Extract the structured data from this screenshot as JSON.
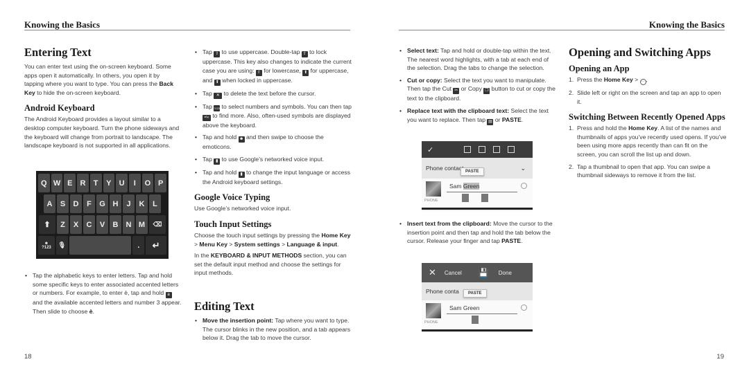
{
  "left_page": {
    "running_head": "Knowing the Basics",
    "page_number": "18",
    "entering_text": {
      "title": "Entering Text",
      "body_pre": "You can enter text using the on-screen keyboard. Some apps open it automatically. In others, you open it by tapping where you want to type. You can press the ",
      "body_bold": "Back Key",
      "body_post": " to hide the on-screen keyboard."
    },
    "android_keyboard": {
      "title": "Android Keyboard",
      "body": "The Android Keyboard provides a layout similar to a desktop computer keyboard. Turn the phone sideways and the keyboard will change from portrait to landscape. The landscape keyboard is not supported in all applications."
    },
    "keyboard": {
      "row1": [
        "Q",
        "W",
        "E",
        "R",
        "T",
        "Y",
        "U",
        "I",
        "O",
        "P"
      ],
      "row2": [
        "A",
        "S",
        "D",
        "F",
        "G",
        "H",
        "J",
        "K",
        "L"
      ],
      "row3": [
        "Z",
        "X",
        "C",
        "V",
        "B",
        "N",
        "M"
      ],
      "symbols_key": "?123",
      "period_key": "."
    },
    "alpha_bullet": {
      "pre": "Tap the alphabetic keys to enter letters. Tap and hold some specific keys to enter associated accented letters or numbers. For example, to enter è, tap and hold ",
      "mid": " and the available accented letters and number 3 appear. Then slide to choose ",
      "bold_end": "è",
      "end": "."
    },
    "bullets": {
      "shift_a": "Tap ",
      "shift_b": " to use uppercase. Double-tap ",
      "shift_c": " to lock uppercase. This key also changes to indicate the current case you are using: ",
      "shift_d": " for lowercase, ",
      "shift_e": " for uppercase, and ",
      "shift_f": " when locked in uppercase.",
      "delete_a": "Tap ",
      "delete_b": " to delete the text before the cursor.",
      "symbols_a": "Tap ",
      "symbols_b": " to select numbers and symbols. You can then tap ",
      "symbols_c": " to find more. Also, often-used symbols are displayed above the keyboard.",
      "emoticons_a": "Tap and hold ",
      "emoticons_b": " and then swipe to choose the emoticons.",
      "voice_a": "Tap ",
      "voice_b": " to use Google’s networked voice input.",
      "lang_a": "Tap and hold ",
      "lang_b": " to change the input language or access the Android keyboard settings.",
      "key_glyph_symbols": "?123",
      "key_glyph_more": "=\\<",
      "key_glyph_a": "a"
    },
    "google_voice": {
      "title": "Google Voice Typing",
      "body": "Use Google’s networked voice input."
    },
    "touch_input": {
      "title": "Touch Input Settings",
      "p1_pre": "Choose the touch input settings by pressing the ",
      "p1_b1": "Home Key",
      "p1_s1": " > ",
      "p1_b2": "Menu Key",
      "p1_s2": " > ",
      "p1_b3": "System settings",
      "p1_s3": " > ",
      "p1_b4": "Language & input",
      "p1_end": ".",
      "p2_pre": "In the ",
      "p2_bold": "KEYBOARD & INPUT METHODS",
      "p2_post": " section, you can set the default input method and choose the settings for input methods."
    },
    "editing_text": {
      "title": "Editing Text",
      "move_bold": "Move the insertion point:",
      "move_text": " Tap where you want to type. The cursor blinks in the new position, and a tab appears below it. Drag the tab to move the cursor."
    }
  },
  "right_page": {
    "running_head": "Knowing the Basics",
    "page_number": "19",
    "editing_bullets": {
      "select_bold": "Select text:",
      "select_text": " Tap and hold or double-tap within the text. The nearest word highlights, with a tab at each end of the selection. Drag the tabs to change the selection.",
      "cut_bold": "Cut or copy:",
      "cut_a": " Select the text you want to manipulate. Then tap the Cut ",
      "cut_b": " or Copy ",
      "cut_c": " button to cut or copy the text to the clipboard.",
      "replace_bold": "Replace text with the clipboard text:",
      "replace_a": " Select the text you want to replace. Then tap ",
      "replace_b": " or ",
      "replace_paste": "PASTE",
      "replace_end": ".",
      "insert_bold": "Insert text from the clipboard:",
      "insert_text": " Move the cursor to the insertion point and then tap and hold the tab below the cursor. Release your finger and tap ",
      "insert_paste": "PASTE",
      "insert_end": "."
    },
    "screenshot1": {
      "field_label": "Phone contact",
      "paste_label": "PASTE",
      "name_first": "Sam ",
      "name_selected": "Green",
      "phone_label": "PHONE"
    },
    "screenshot2": {
      "cancel_label": "Cancel",
      "done_label": "Done",
      "field_label": "Phone conta",
      "paste_label": "PASTE",
      "name": "Sam Green",
      "phone_label": "PHONE"
    },
    "opening_switching": {
      "title": "Opening and Switching Apps",
      "opening_title": "Opening an App",
      "open_steps": [
        {
          "num": "1.",
          "pre": "Press the ",
          "bold": "Home Key",
          "post": " > ",
          "icon": "apps-icon",
          "end": "."
        },
        {
          "num": "2.",
          "text": "Slide left or right on the screen and tap an app to open it."
        }
      ],
      "switching_title": "Switching Between Recently Opened Apps",
      "switch_steps": [
        {
          "num": "1.",
          "pre": "Press and hold the ",
          "bold": "Home Key",
          "post": ". A list of the names and thumbnails of apps you’ve recently used opens. If you’ve been using more apps recently than can fit on the screen, you can scroll the list up and down."
        },
        {
          "num": "2.",
          "text": "Tap a thumbnail to open that app. You can swipe a thumbnail sideways to remove it from the list."
        }
      ]
    }
  }
}
